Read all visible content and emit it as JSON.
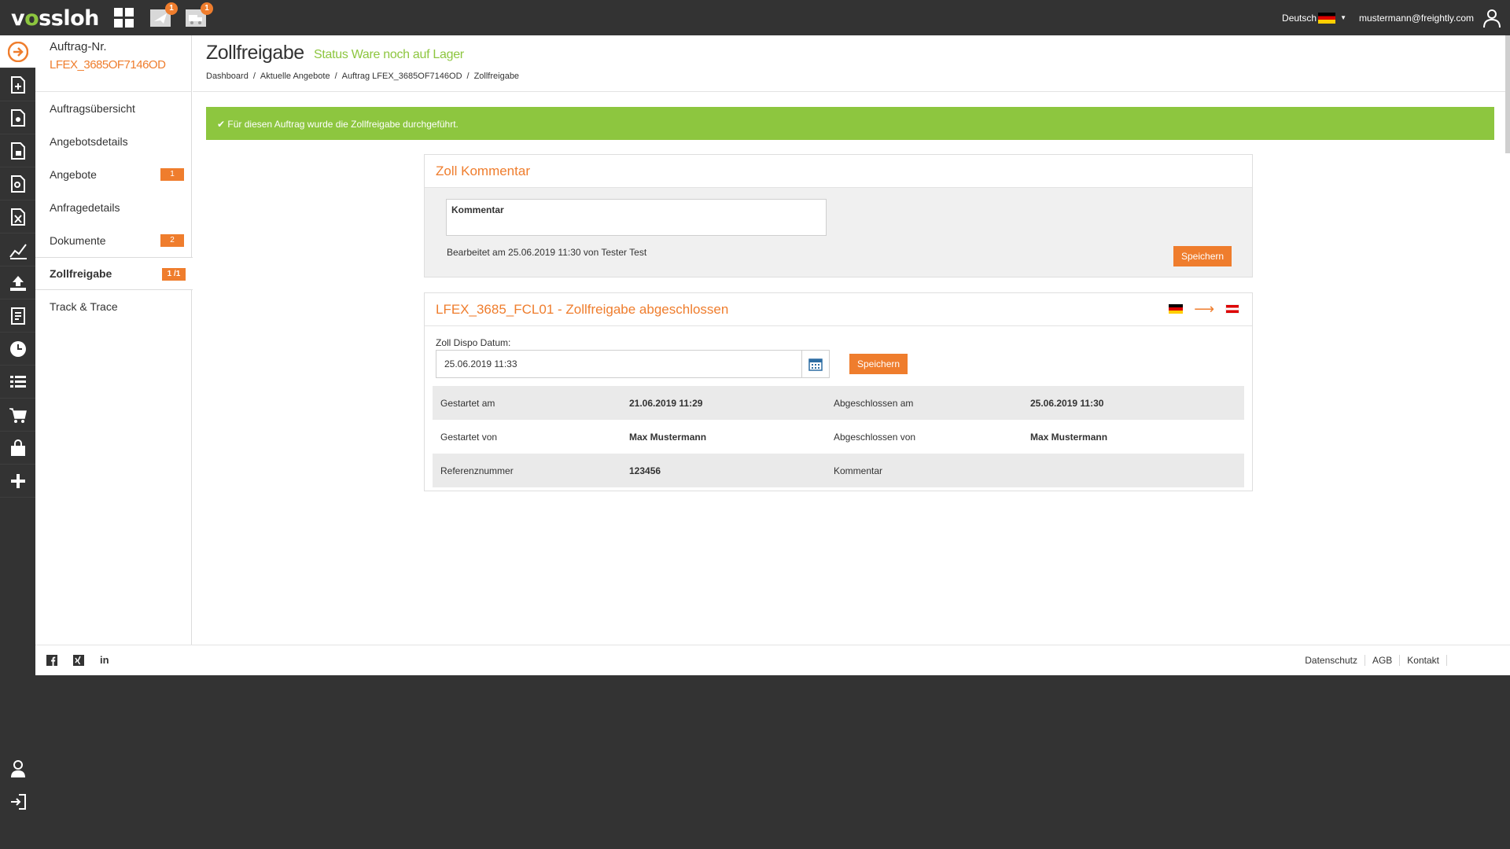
{
  "topbar": {
    "logo_a": "v",
    "logo_o": "o",
    "logo_b": "ssloh",
    "notif_badge_1": "1",
    "notif_badge_2": "1",
    "language": "Deutsch",
    "user_email": "mustermann@freightly.com"
  },
  "order": {
    "label": "Auftrag-Nr.",
    "id": "LFEX_3685OF7146OD"
  },
  "subnav": {
    "items": [
      {
        "label": "Auftragsübersicht",
        "badge": ""
      },
      {
        "label": "Angebotsdetails",
        "badge": ""
      },
      {
        "label": "Angebote",
        "badge": "1"
      },
      {
        "label": "Anfragedetails",
        "badge": ""
      },
      {
        "label": "Dokumente",
        "badge": "2"
      },
      {
        "label": "Zollfreigabe",
        "badge": "1 /1"
      },
      {
        "label": "Track & Trace",
        "badge": ""
      }
    ]
  },
  "page": {
    "title": "Zollfreigabe",
    "status": "Status Ware noch auf Lager",
    "breadcrumb": [
      "Dashboard",
      "Aktuelle Angebote",
      "Auftrag LFEX_3685OF7146OD",
      "Zollfreigabe"
    ]
  },
  "alert": {
    "text": "✔ Für diesen Auftrag wurde die Zollfreigabe durchgeführt."
  },
  "comment_card": {
    "title": "Zoll Kommentar",
    "textarea_label": "Kommentar",
    "edited": "Bearbeitet am 25.06.2019 11:30 von Tester Test",
    "save_label": "Speichern"
  },
  "clearance_card": {
    "title": "LFEX_3685_FCL01 - Zollfreigabe abgeschlossen",
    "date_label": "Zoll Dispo Datum:",
    "date_value": "25.06.2019 11:33",
    "save_label": "Speichern",
    "rows": [
      {
        "l1": "Gestartet am",
        "v1": "21.06.2019 11:29",
        "l2": "Abgeschlossen am",
        "v2": "25.06.2019 11:30"
      },
      {
        "l1": "Gestartet von",
        "v1": "Max Mustermann",
        "l2": "Abgeschlossen von",
        "v2": "Max Mustermann"
      },
      {
        "l1": "Referenznummer",
        "v1": "123456",
        "l2": "Kommentar",
        "v2": ""
      }
    ]
  },
  "footer": {
    "links": [
      "Datenschutz",
      "AGB",
      "Kontakt"
    ],
    "linkedin": "in"
  },
  "colors": {
    "accent": "#ef7d2d",
    "success": "#8dc63f",
    "dark": "#333333"
  }
}
